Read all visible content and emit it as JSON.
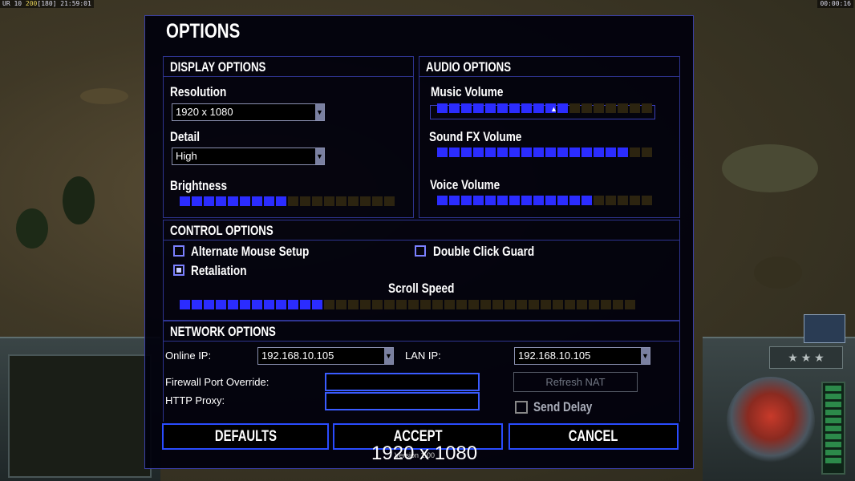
{
  "hud": {
    "top_left_prefix": "UR 10",
    "top_left_highlight": "200",
    "top_left_suffix": "[180] 21:59:01",
    "top_right_time": "00:00:16"
  },
  "dialog": {
    "title": "OPTIONS",
    "display": {
      "header": "DISPLAY OPTIONS",
      "resolution_label": "Resolution",
      "resolution_value": "1920 x 1080",
      "detail_label": "Detail",
      "detail_value": "High",
      "brightness_label": "Brightness",
      "brightness_level": 0.5
    },
    "audio": {
      "header": "AUDIO OPTIONS",
      "music_label": "Music Volume",
      "music_level": 0.6,
      "sfx_label": "Sound FX Volume",
      "sfx_level": 0.87,
      "voice_label": "Voice Volume",
      "voice_level": 0.73
    },
    "control": {
      "header": "CONTROL OPTIONS",
      "alt_mouse_label": "Alternate Mouse Setup",
      "alt_mouse_checked": false,
      "retaliation_label": "Retaliation",
      "retaliation_checked": true,
      "double_click_label": "Double Click Guard",
      "double_click_checked": false,
      "scroll_speed_label": "Scroll Speed",
      "scroll_speed_level": 0.32
    },
    "network": {
      "header": "NETWORK OPTIONS",
      "online_ip_label": "Online IP:",
      "online_ip_value": "192.168.10.105",
      "lan_ip_label": "LAN IP:",
      "lan_ip_value": "192.168.10.105",
      "firewall_label": "Firewall Port Override:",
      "firewall_value": "",
      "http_proxy_label": "HTTP Proxy:",
      "http_proxy_value": "",
      "refresh_nat_label": "Refresh NAT",
      "send_delay_label": "Send Delay",
      "send_delay_checked": false
    },
    "buttons": {
      "defaults": "DEFAULTS",
      "accept": "ACCEPT",
      "cancel": "CANCEL"
    },
    "resolution_overlay": "1920 x 1080",
    "version_text": "Version 1.00"
  },
  "colors": {
    "slider_on": "#2b2cff",
    "slider_off": "#2c2410",
    "section_border": "#2e3490",
    "button_border": "#2a4cff"
  },
  "icons": [
    "dropdown-arrow-icon",
    "slider-thumb-icon",
    "star-icon",
    "power-bar-icon",
    "faction-emblem-icon"
  ]
}
